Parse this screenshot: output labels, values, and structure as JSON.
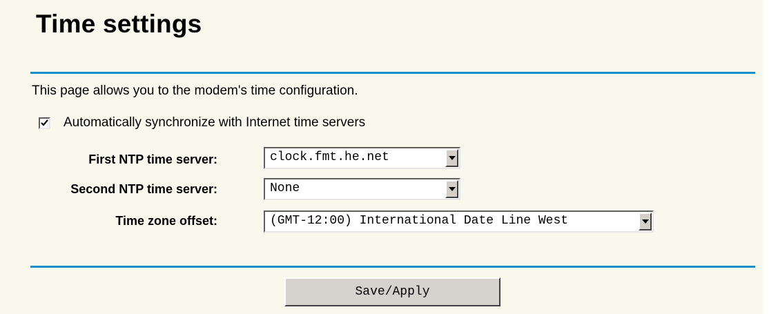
{
  "page": {
    "title": "Time settings",
    "description": "This page allows you to the modem's time configuration."
  },
  "auto_sync": {
    "checked": true,
    "label": "Automatically synchronize with Internet time servers"
  },
  "fields": {
    "first_ntp": {
      "label": "First NTP time server:",
      "value": "clock.fmt.he.net"
    },
    "second_ntp": {
      "label": "Second NTP time server:",
      "value": "None"
    },
    "timezone": {
      "label": "Time zone offset:",
      "value": "(GMT-12:00) International Date Line West"
    }
  },
  "actions": {
    "save_label": "Save/Apply"
  },
  "colors": {
    "background": "#f9f8ec",
    "divider": "#1a8fc9",
    "button_face": "#d6d3ce"
  }
}
